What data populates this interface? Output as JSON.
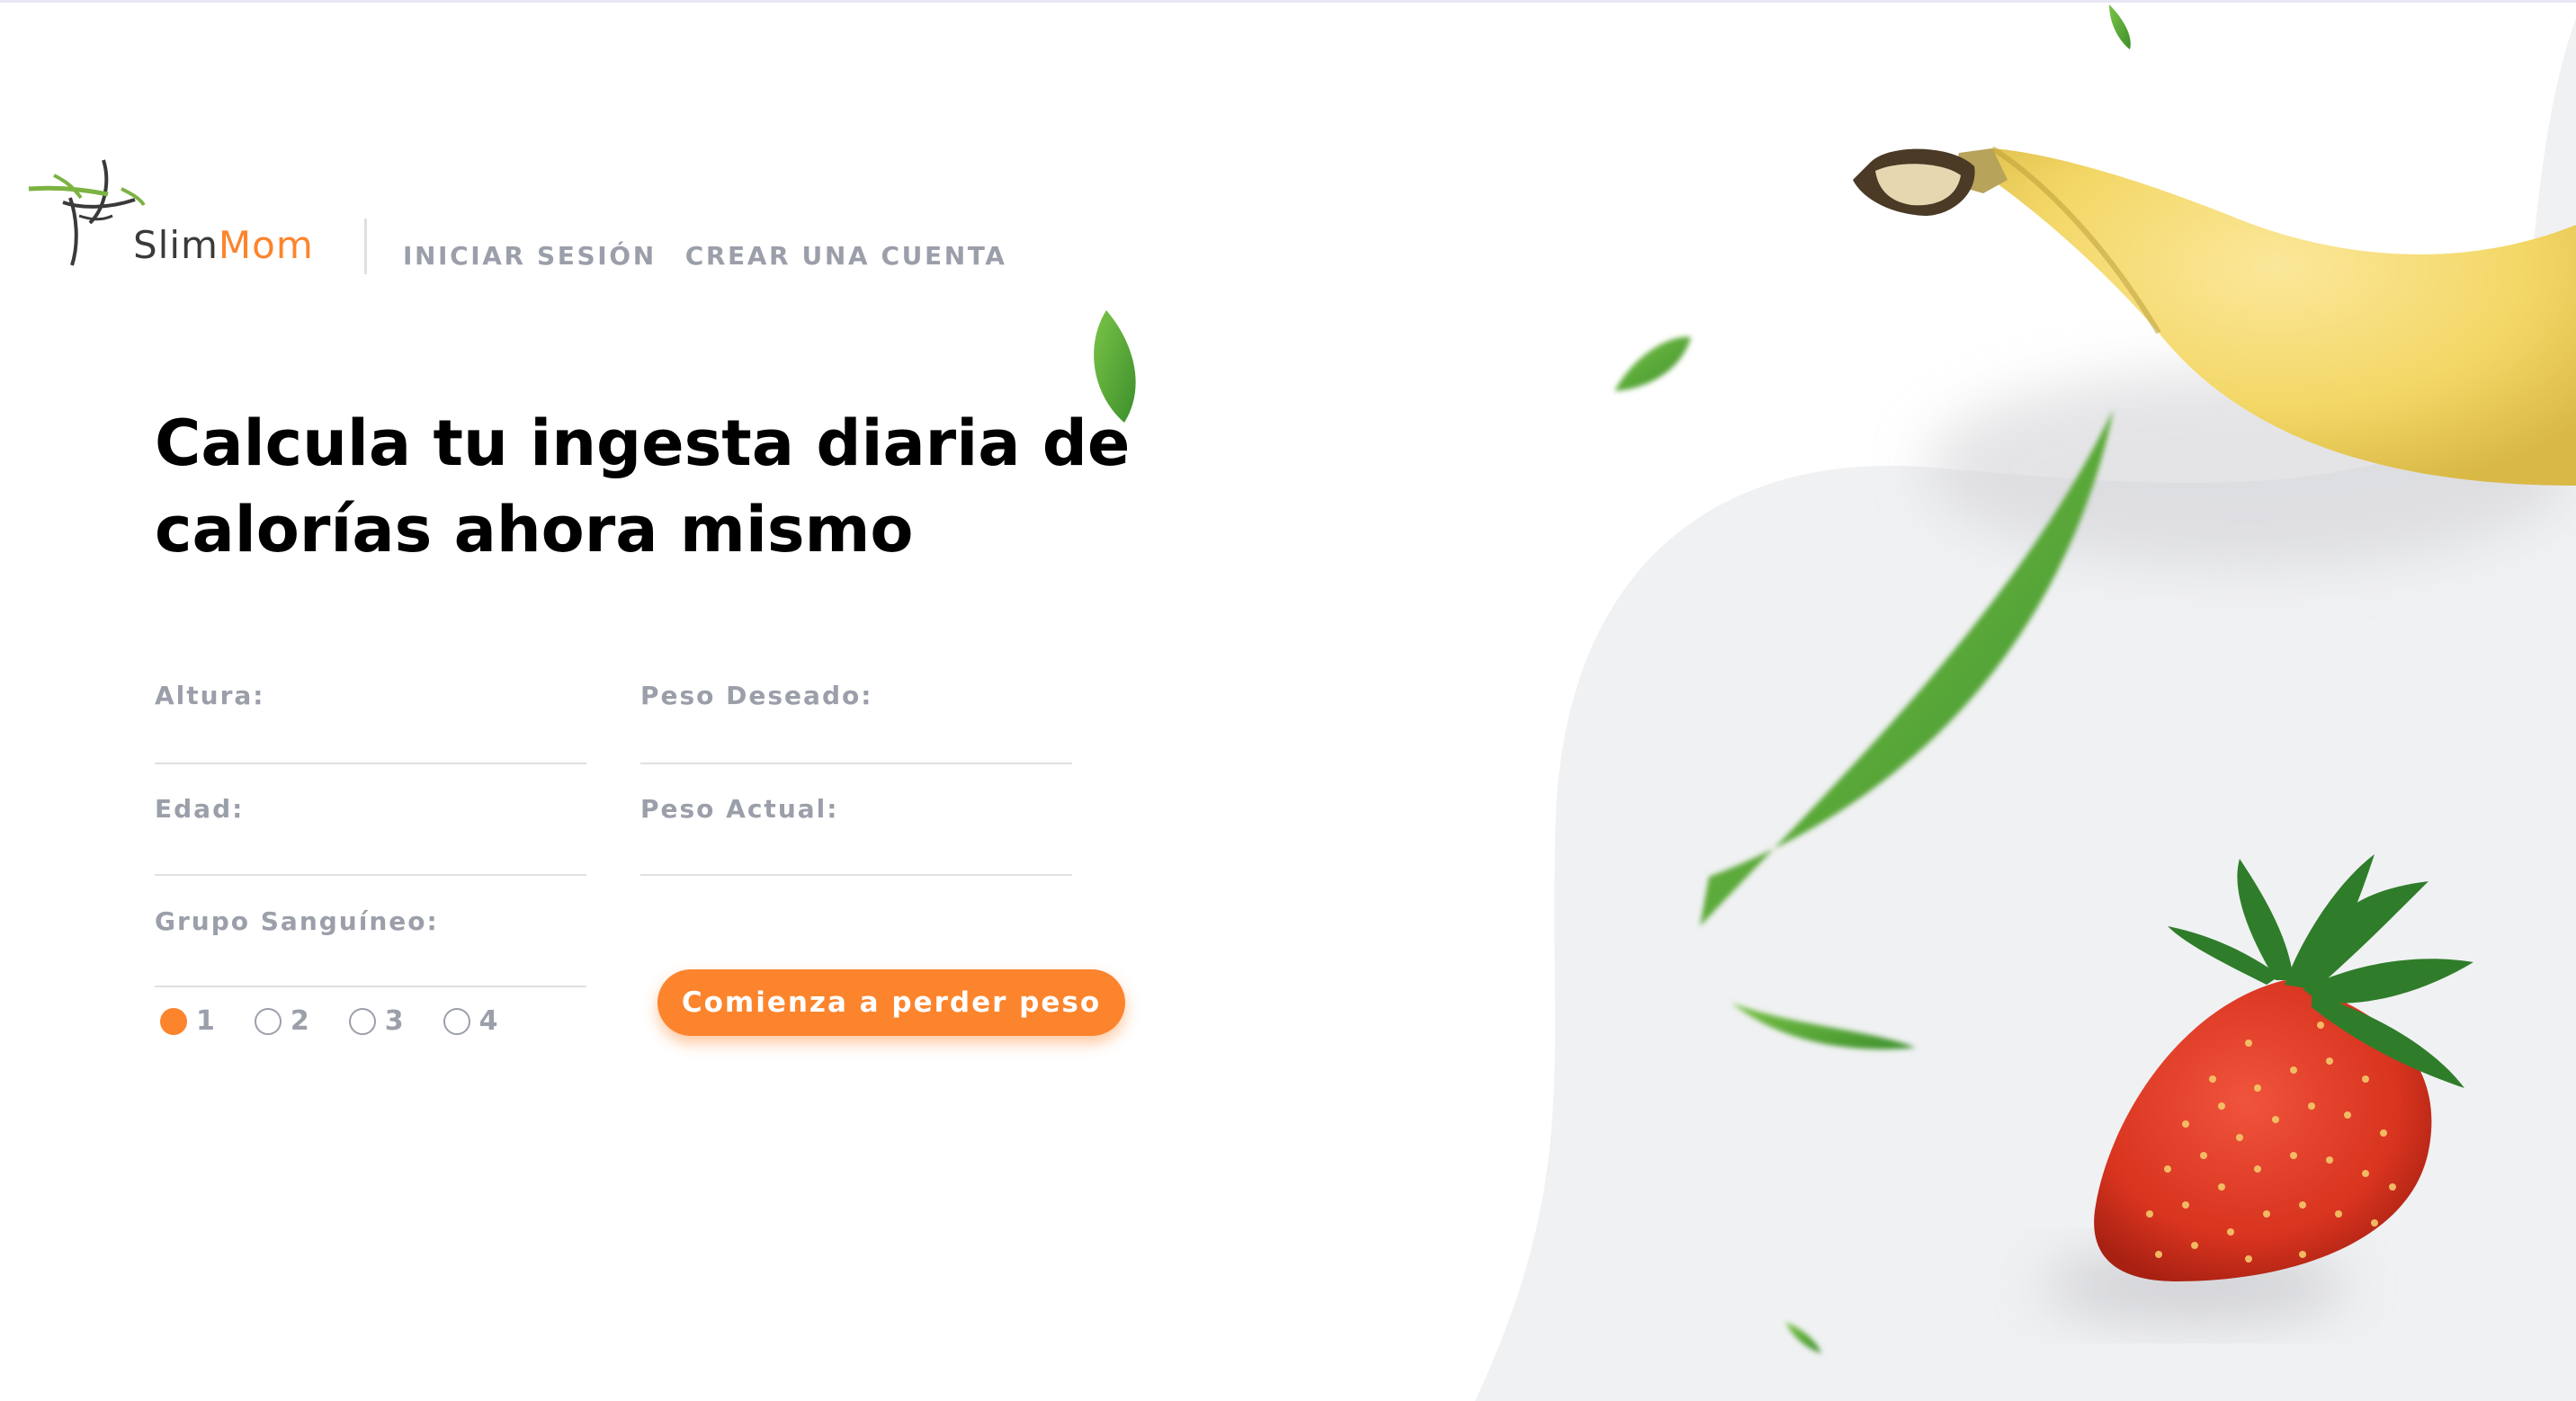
{
  "brand": {
    "name_part1": "Slim",
    "name_part2": "Mom",
    "accent_color": "#fc842d",
    "muted_color": "#9b9faa"
  },
  "nav": {
    "login_label": "INICIAR SESIÓN",
    "register_label": "CREAR UNA CUENTA"
  },
  "headline": "Calcula tu ingesta diaria de calorías ahora mismo",
  "form": {
    "height_label": "Altura:",
    "height_value": "",
    "desired_weight_label": "Peso Deseado:",
    "desired_weight_value": "",
    "age_label": "Edad:",
    "age_value": "",
    "current_weight_label": "Peso Actual:",
    "current_weight_value": "",
    "blood_type_label": "Grupo Sanguíneo:",
    "blood_type_options": [
      "1",
      "2",
      "3",
      "4"
    ],
    "blood_type_selected": "1",
    "submit_label": "Comienza a perder peso"
  },
  "decorations": {
    "icons": [
      "banana-image",
      "strawberry-image",
      "leaf-icon"
    ]
  }
}
